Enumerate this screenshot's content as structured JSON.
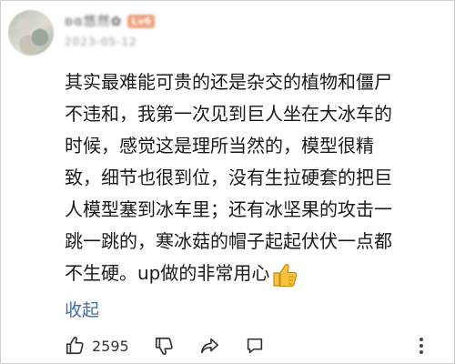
{
  "comment": {
    "author": {
      "name": "ʚɞ悠然✿",
      "level_badge": "Lv6"
    },
    "timestamp": "2023-05-12",
    "text": "其实最难能可贵的还是杂交的植物和僵尸\n不违和，我第一次见到巨人坐在大冰车的\n时候，感觉这是理所当然的，模型很精\n致，细节也很到位，没有生拉硬套的把巨\n人模型塞到冰车里；还有冰坚果的攻击一\n跳一跳的，寒冰菇的帽子起起伏伏一点都\n不生硬。up做的非常用心",
    "emoji": "thumbs-up-emoji",
    "collapse_label": "收起"
  },
  "actions": {
    "like_count": "2595",
    "icons": [
      "like-icon",
      "dislike-icon",
      "share-icon",
      "reply-icon",
      "more-icon"
    ]
  },
  "colors": {
    "link": "#3b6db0",
    "text": "#1a1a1a",
    "muted": "#999999",
    "emoji_yellow": "#f7c23c"
  }
}
